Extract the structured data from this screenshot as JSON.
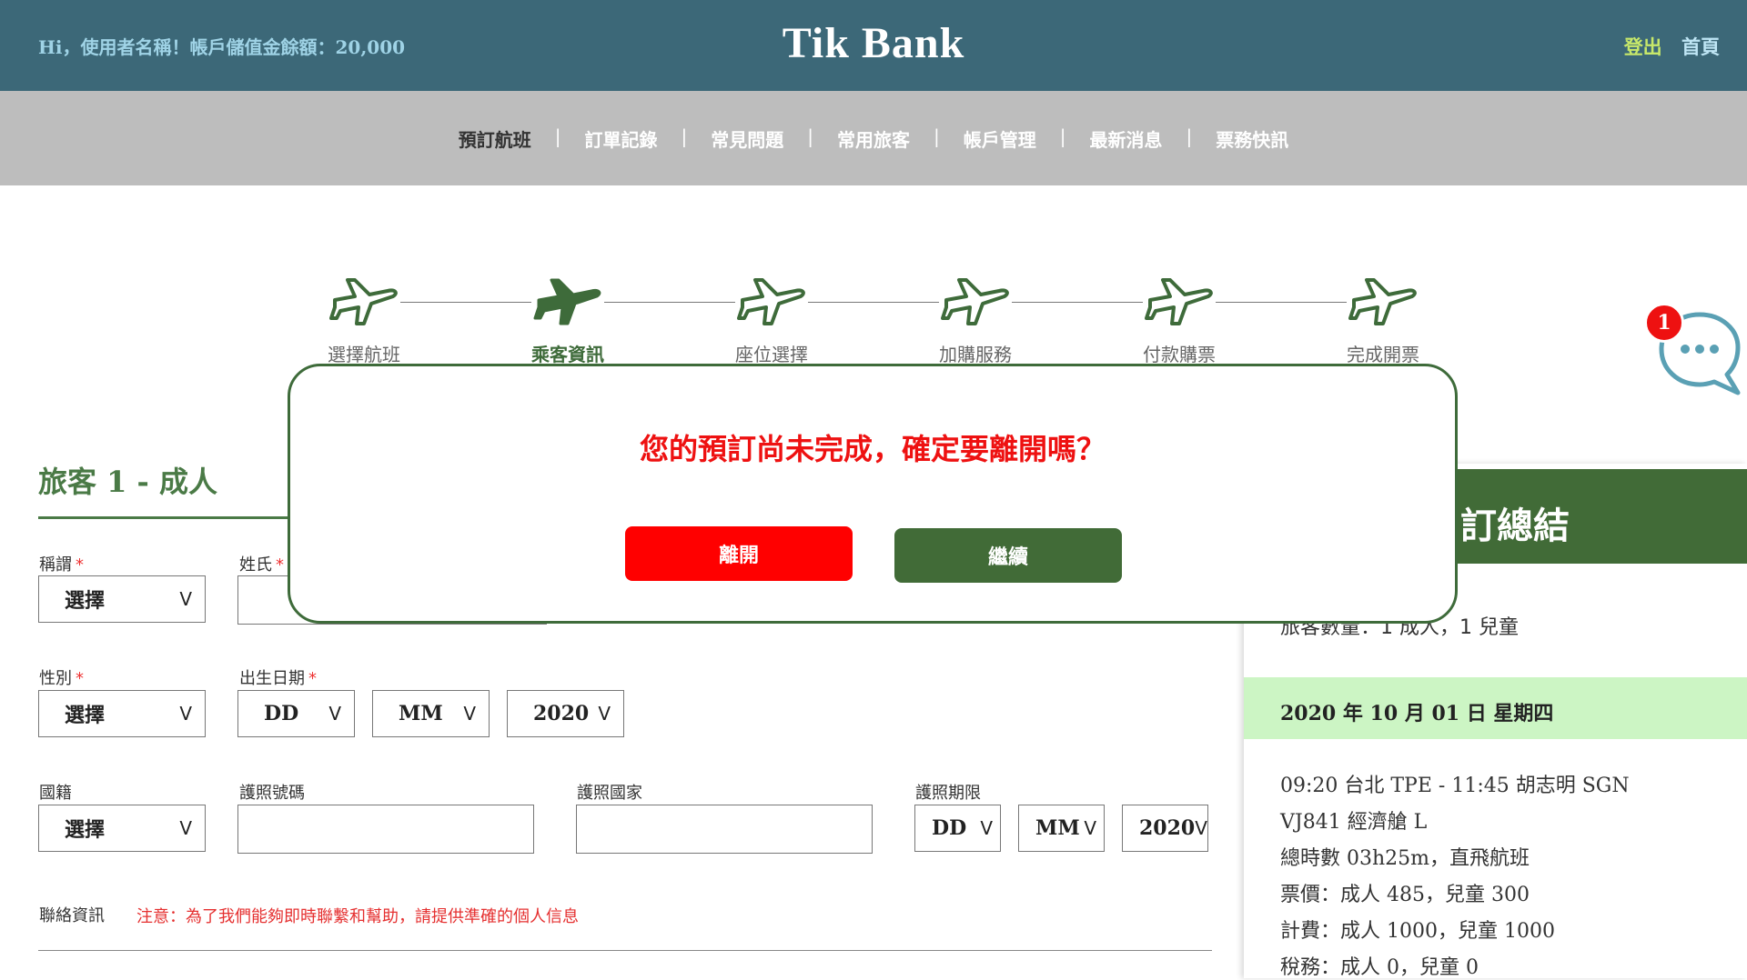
{
  "header": {
    "greeting": "Hi，使用者名稱！帳戶儲值金餘額：20,000",
    "brand": "Tik Bank",
    "logout": "登出",
    "home": "首頁"
  },
  "nav": {
    "items": [
      "預訂航班",
      "訂單記錄",
      "常見問題",
      "常用旅客",
      "帳戶管理",
      "最新消息",
      "票務快訊"
    ],
    "separator": "|"
  },
  "steps": [
    "選擇航班",
    "乘客資訊",
    "座位選擇",
    "加購服務",
    "付款購票",
    "完成開票"
  ],
  "form": {
    "title": "旅客 1 - 成人",
    "required_mark": "*",
    "title_label": "稱謂",
    "surname_label": "姓氏",
    "gender_label": "性別",
    "dob_label": "出生日期",
    "nationality_label": "國籍",
    "passport_no_label": "護照號碼",
    "passport_country_label": "護照國家",
    "passport_expiry_label": "護照期限",
    "select_text": "選擇",
    "dd": "DD",
    "mm": "MM",
    "year": "2020",
    "chevron": "V",
    "contact_label": "聯絡資訊",
    "contact_note": "注意：為了我們能夠即時聯繫和幫助，請提供準確的個人信息"
  },
  "summary": {
    "title_visible": "訂總結",
    "pax": "旅客數量：1 成人，1 兒童",
    "date": "2020 年 10 月 01 日 星期四",
    "lines": [
      "09:20 台北 TPE - 11:45 胡志明 SGN",
      "VJ841 經濟艙 L",
      "總時數 03h25m，直飛航班",
      "票價：成人 485，兒童 300",
      "計費：成人 1000，兒童 1000",
      "稅務：成人 0，兒童 0"
    ]
  },
  "dialog": {
    "message": "您的預訂尚未完成，確定要離開嗎？",
    "leave": "離開",
    "continue": "繼續"
  },
  "chat": {
    "badge": "1",
    "icon": "chat-bubble-icon"
  },
  "colors": {
    "header": "#3c6878",
    "green": "#416b37",
    "red": "#ff0000",
    "light_green": "#ccf5c4"
  }
}
